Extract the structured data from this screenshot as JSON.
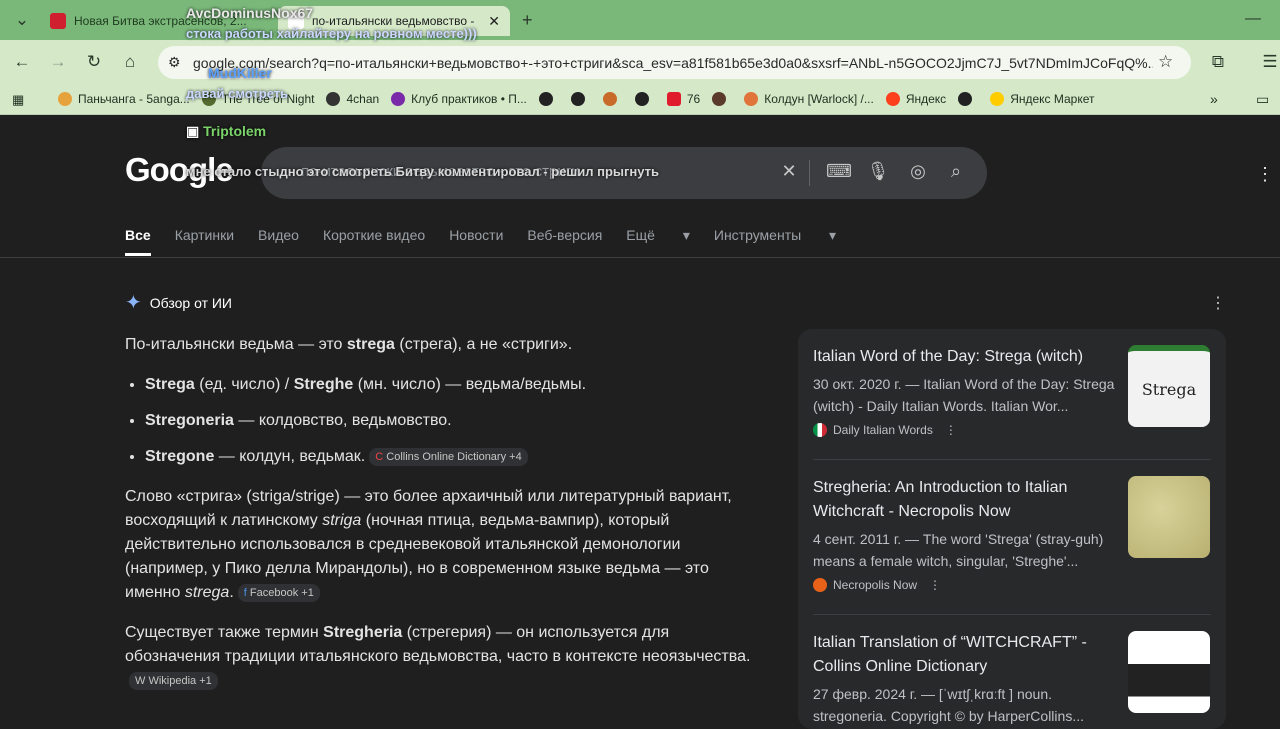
{
  "browser": {
    "tabs": [
      {
        "title": "Новая Битва экстрасенсов, 2...",
        "favicon": "R",
        "active": false
      },
      {
        "title": "по-итальянски ведьмовство -",
        "favicon": "G",
        "active": true
      }
    ],
    "new_tab_label": "+",
    "url": "google.com/search?q=по-итальянски+ведьмовство+-+это+стриги&sca_esv=a81f581b65e3d0a0&sxsrf=ANbL-n5GOCO2JjmC7J_5vt7NDmImJCoFqQ%...",
    "bookmarks": [
      "Паньчанга - 5anga...",
      "The Tree of Night",
      "4chan",
      "Клуб практиков • П...",
      "",
      "",
      "",
      "",
      "76",
      "",
      "Колдун [Warlock] /...",
      "Яндекс",
      "",
      "Яндекс Маркет"
    ]
  },
  "overlay_chat": [
    {
      "user": "AvcDominusNox67",
      "text": "стока работы хайлайтеру на ровном месте)))"
    },
    {
      "user": "MudKiller",
      "text": "давай смотреть"
    },
    {
      "user": "Triptolem",
      "text": "мне стало стыдно это смотреть Битву комментировал - решил прыгнуть"
    }
  ],
  "google": {
    "logo": "Google",
    "query": "по-итальянски ведьмовство - это стриги",
    "tabs": [
      "Все",
      "Картинки",
      "Видео",
      "Короткие видео",
      "Новости",
      "Веб-версия",
      "Ещё",
      "Инструменты"
    ]
  },
  "ai_overview": {
    "title": "Обзор от ИИ",
    "intro": [
      "По-итальянски ведьма — это ",
      "strega",
      " (стрега), а не «стриги»."
    ],
    "bullets": [
      {
        "bold": "Strega",
        "rest": " (ед. число) / ",
        "bold2": "Streghe",
        "rest2": " (мн. число) — ведьма/ведьмы.",
        "pill": ""
      },
      {
        "bold": "Stregoneria",
        "rest": " — колдовство, ведьмовство.",
        "bold2": "",
        "rest2": "",
        "pill": ""
      },
      {
        "bold": "Stregone",
        "rest": " — колдун, ведьмак.",
        "bold2": "",
        "rest2": "",
        "pill": "Collins Online Dictionary +4"
      }
    ],
    "para2_a": "Слово «стрига» (striga/strige) — это более архаичный или литературный вариант, восходящий к латинскому ",
    "para2_i": "striga",
    "para2_b": " (ночная птица, ведьма-вампир), который действительно использовался в средневековой итальянской демонологии (например, у Пико делла Мирандолы), но в современном языке ведьма — это именно ",
    "para2_i2": "strega",
    "para2_c": ".",
    "para2_pill": "Facebook +1",
    "para3_a": "Существует также термин ",
    "para3_b": "Stregheria",
    "para3_c": " (стрегерия) — он используется для обозначения традиции итальянского ведьмовства, часто в контексте неоязычества.",
    "para3_pill": "Wikipedia +1"
  },
  "results": [
    {
      "title": "Italian Word of the Day: Strega (witch)",
      "snippet": "30 окт. 2020 г. — Italian Word of the Day: Strega (witch) - Daily Italian Words. Italian Wor...",
      "source": "Daily Italian Words",
      "thumb_text": "Strega"
    },
    {
      "title": "Stregheria: An Introduction to Italian Witchcraft - Necropolis Now",
      "snippet": "4 сент. 2011 г. — The word 'Strega' (stray-guh) means a female witch, singular, 'Streghe'...",
      "source": "Necropolis Now",
      "thumb_text": ""
    },
    {
      "title": "Italian Translation of “WITCHCRAFT” - Collins Online Dictionary",
      "snippet": "27 февр. 2024 г. — [ˈwɪtʃˌkrɑːft ] noun. stregoneria. Copyright © by HarperCollins...",
      "source": "",
      "thumb_text": ""
    }
  ],
  "colors": {
    "page_bg": "#1f1f1f",
    "tab_strip": "#7ab87a",
    "toolbar": "#d5e9c9",
    "panel": "#28292a"
  }
}
